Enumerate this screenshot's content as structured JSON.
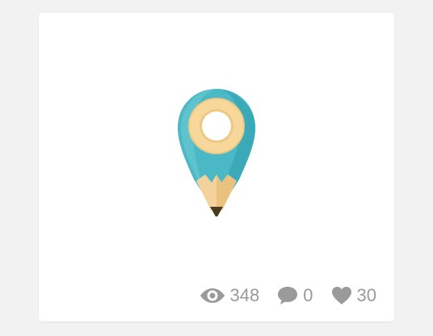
{
  "card": {
    "logo_icon": "map-pin-pencil-icon",
    "colors": {
      "pin": "#4bb8c6",
      "pin_shade": "#3aa9b8",
      "pin_light": "#6cc9d4",
      "ring": "#f7d79a",
      "ring_shade": "#ecc885",
      "pencil_wood": "#f3d39b",
      "pencil_lead": "#4b3a1e",
      "stats_text": "#9a9a9a"
    },
    "stats": {
      "views": {
        "icon": "eye-icon",
        "value": "348"
      },
      "comments": {
        "icon": "speech-bubble-icon",
        "value": "0"
      },
      "likes": {
        "icon": "heart-icon",
        "value": "30"
      }
    }
  }
}
